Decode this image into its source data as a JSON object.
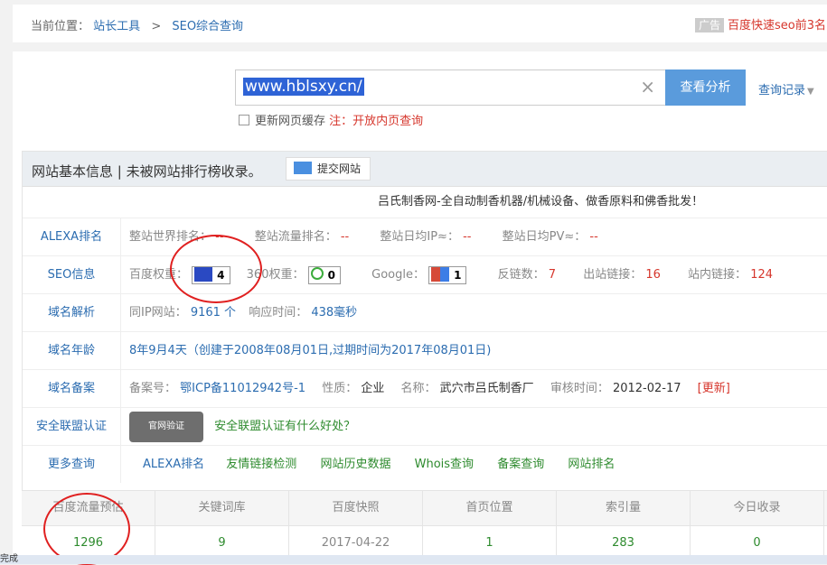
{
  "breadcrumb": {
    "prefix": "当前位置：",
    "home": "站长工具",
    "sep": ">",
    "current": "SEO综合查询"
  },
  "ad": {
    "tag": "广告",
    "text": "百度快速seo前3名"
  },
  "search": {
    "value": "www.hblsxy.cn/",
    "clear": "×",
    "button": "查看分析",
    "history": "查询记录",
    "history_caret": "▼"
  },
  "refresh": {
    "label": "更新网页缓存",
    "note": "注：开放内页查询"
  },
  "basic": {
    "title": "网站基本信息  | 未被网站排行榜收录。",
    "submit": "提交网站",
    "description": "吕氏制香网-全自动制香机器/机械设备、做香原料和佛香批发！"
  },
  "alexa": {
    "label": "ALEXA排名",
    "world_label": "整站世界排名：",
    "world_value": "--",
    "traffic_label": "整站流量排名：",
    "traffic_value": "--",
    "ip_label": "整站日均IP≈：",
    "ip_value": "--",
    "pv_label": "整站日均PV≈：",
    "pv_value": "--"
  },
  "seo": {
    "label": "SEO信息",
    "baidu_label": "百度权重：",
    "baidu_value": "4",
    "s360_label": "360权重：",
    "s360_value": "0",
    "google_label": "Google：",
    "google_value": "1",
    "backlinks_label": "反链数：",
    "backlinks_value": "7",
    "outlinks_label": "出站链接：",
    "outlinks_value": "16",
    "inlinks_label": "站内链接：",
    "inlinks_value": "124"
  },
  "dns": {
    "label": "域名解析",
    "sameip_label": "同IP网站：",
    "sameip_value": "9161 个",
    "resp_label": "响应时间：",
    "resp_value": "438毫秒"
  },
  "age": {
    "label": "域名年龄",
    "value": "8年9月4天（创建于2008年08月01日,过期时间为2017年08月01日)"
  },
  "beian": {
    "label": "域名备案",
    "no_label": "备案号：",
    "no_value": "鄂ICP备11012942号-1",
    "nature_label": "性质：",
    "nature_value": "企业",
    "name_label": "名称：",
    "name_value": "武穴市吕氏制香厂",
    "date_label": "审核时间：",
    "date_value": "2012-02-17",
    "update": "[更新]"
  },
  "security": {
    "label": "安全联盟认证",
    "seal": "官网验证",
    "link": "安全联盟认证有什么好处？"
  },
  "more": {
    "label": "更多查询",
    "links": [
      "ALEXA排名",
      "友情链接检测",
      "网站历史数据",
      "Whois查询",
      "备案查询",
      "网站排名"
    ]
  },
  "stats": {
    "headers": [
      "百度流量预估",
      "关键词库",
      "百度快照",
      "首页位置",
      "索引量",
      "今日收录"
    ],
    "values": [
      "1296",
      "9",
      "2017-04-22",
      "1",
      "283",
      "0"
    ]
  },
  "status": "完成",
  "colors": {
    "accent": "#5a9bdc",
    "link": "#2b6cb0",
    "warn": "#d6362c",
    "ok": "#2e8b2e",
    "annotation": "#e02020"
  }
}
